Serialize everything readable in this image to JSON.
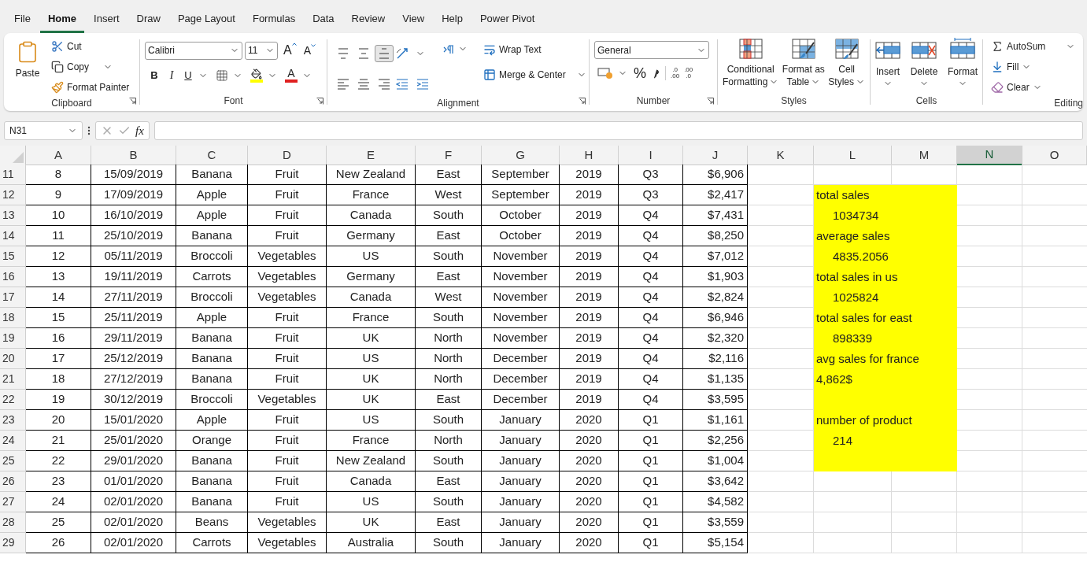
{
  "menu_tabs": [
    {
      "label": "File",
      "selected": false
    },
    {
      "label": "Home",
      "selected": true
    },
    {
      "label": "Insert",
      "selected": false
    },
    {
      "label": "Draw",
      "selected": false
    },
    {
      "label": "Page Layout",
      "selected": false
    },
    {
      "label": "Formulas",
      "selected": false
    },
    {
      "label": "Data",
      "selected": false
    },
    {
      "label": "Review",
      "selected": false
    },
    {
      "label": "View",
      "selected": false
    },
    {
      "label": "Help",
      "selected": false
    },
    {
      "label": "Power Pivot",
      "selected": false
    }
  ],
  "clipboard": {
    "paste": "Paste",
    "cut": "Cut",
    "copy": "Copy",
    "format_painter": "Format Painter",
    "label": "Clipboard"
  },
  "font": {
    "name": "Calibri",
    "size": "11",
    "grow": "A",
    "shrink": "A",
    "bold": "B",
    "italic": "I",
    "underline": "U",
    "font_color": "A",
    "label": "Font"
  },
  "alignment": {
    "wrap_text": "Wrap Text",
    "merge_center": "Merge & Center",
    "label": "Alignment"
  },
  "number": {
    "format": "General",
    "percent": "%",
    "increase_decimal": [
      ".0",
      ".00"
    ],
    "decrease_decimal": [
      ".00",
      ".0"
    ],
    "label": "Number"
  },
  "styles": {
    "buttons": [
      [
        "Conditional",
        "Formatting"
      ],
      [
        "Format as",
        "Table"
      ],
      [
        "Cell",
        "Styles"
      ]
    ],
    "label": "Styles"
  },
  "cells": {
    "buttons": [
      "Insert",
      "Delete",
      "Format"
    ],
    "label": "Cells"
  },
  "editing": {
    "autosum": "AutoSum",
    "fill": "Fill",
    "clear": "Clear",
    "label": "Editing"
  },
  "formula_bar": {
    "name_box": "N31",
    "fx": "fx"
  },
  "columns": [
    {
      "label": "A",
      "selected": false
    },
    {
      "label": "B",
      "selected": false
    },
    {
      "label": "C",
      "selected": false
    },
    {
      "label": "D",
      "selected": false
    },
    {
      "label": "E",
      "selected": false
    },
    {
      "label": "F",
      "selected": false
    },
    {
      "label": "G",
      "selected": false
    },
    {
      "label": "H",
      "selected": false
    },
    {
      "label": "I",
      "selected": false
    },
    {
      "label": "J",
      "selected": false
    },
    {
      "label": "K",
      "selected": false
    },
    {
      "label": "L",
      "selected": false
    },
    {
      "label": "M",
      "selected": false
    },
    {
      "label": "N",
      "selected": true
    },
    {
      "label": "O",
      "selected": false
    }
  ],
  "rows": [
    {
      "number": "11",
      "cells": [
        "8",
        "15/09/2019",
        "Banana",
        "Fruit",
        "New Zealand",
        "East",
        "September",
        "2019",
        "Q3",
        "$6,906"
      ],
      "highlight": false
    },
    {
      "number": "12",
      "cells": [
        "9",
        "17/09/2019",
        "Apple",
        "Fruit",
        "France",
        "West",
        "September",
        "2019",
        "Q3",
        "$2,417"
      ],
      "highlight": true,
      "note": {
        "text": "total sales",
        "kind": "label"
      }
    },
    {
      "number": "13",
      "cells": [
        "10",
        "16/10/2019",
        "Apple",
        "Fruit",
        "Canada",
        "South",
        "October",
        "2019",
        "Q4",
        "$7,431"
      ],
      "highlight": true,
      "note": {
        "text": "1034734",
        "kind": "value"
      }
    },
    {
      "number": "14",
      "cells": [
        "11",
        "25/10/2019",
        "Banana",
        "Fruit",
        "Germany",
        "East",
        "October",
        "2019",
        "Q4",
        "$8,250"
      ],
      "highlight": true,
      "note": {
        "text": "average sales",
        "kind": "label"
      }
    },
    {
      "number": "15",
      "cells": [
        "12",
        "05/11/2019",
        "Broccoli",
        "Vegetables",
        "US",
        "South",
        "November",
        "2019",
        "Q4",
        "$7,012"
      ],
      "highlight": true,
      "note": {
        "text": "4835.2056",
        "kind": "value"
      }
    },
    {
      "number": "16",
      "cells": [
        "13",
        "19/11/2019",
        "Carrots",
        "Vegetables",
        "Germany",
        "East",
        "November",
        "2019",
        "Q4",
        "$1,903"
      ],
      "highlight": true,
      "note": {
        "text": "total sales in us",
        "kind": "label"
      }
    },
    {
      "number": "17",
      "cells": [
        "14",
        "27/11/2019",
        "Broccoli",
        "Vegetables",
        "Canada",
        "West",
        "November",
        "2019",
        "Q4",
        "$2,824"
      ],
      "highlight": true,
      "note": {
        "text": "1025824",
        "kind": "value"
      }
    },
    {
      "number": "18",
      "cells": [
        "15",
        "25/11/2019",
        "Apple",
        "Fruit",
        "France",
        "South",
        "November",
        "2019",
        "Q4",
        "$6,946"
      ],
      "highlight": true,
      "note": {
        "text": "total sales for east",
        "kind": "label"
      }
    },
    {
      "number": "19",
      "cells": [
        "16",
        "29/11/2019",
        "Banana",
        "Fruit",
        "UK",
        "North",
        "November",
        "2019",
        "Q4",
        "$2,320"
      ],
      "highlight": true,
      "note": {
        "text": "898339",
        "kind": "value"
      }
    },
    {
      "number": "20",
      "cells": [
        "17",
        "25/12/2019",
        "Banana",
        "Fruit",
        "US",
        "North",
        "December",
        "2019",
        "Q4",
        "$2,116"
      ],
      "highlight": true,
      "note": {
        "text": "avg sales for france",
        "kind": "label"
      }
    },
    {
      "number": "21",
      "cells": [
        "18",
        "27/12/2019",
        "Banana",
        "Fruit",
        "UK",
        "North",
        "December",
        "2019",
        "Q4",
        "$1,135"
      ],
      "highlight": true,
      "note": {
        "text": "4,862$",
        "kind": "label"
      }
    },
    {
      "number": "22",
      "cells": [
        "19",
        "30/12/2019",
        "Broccoli",
        "Vegetables",
        "UK",
        "East",
        "December",
        "2019",
        "Q4",
        "$3,595"
      ],
      "highlight": true
    },
    {
      "number": "23",
      "cells": [
        "20",
        "15/01/2020",
        "Apple",
        "Fruit",
        "US",
        "South",
        "January",
        "2020",
        "Q1",
        "$1,161"
      ],
      "highlight": true,
      "note": {
        "text": "number of product",
        "kind": "label"
      }
    },
    {
      "number": "24",
      "cells": [
        "21",
        "25/01/2020",
        "Orange",
        "Fruit",
        "France",
        "North",
        "January",
        "2020",
        "Q1",
        "$2,256"
      ],
      "highlight": true,
      "note": {
        "text": "214",
        "kind": "value"
      }
    },
    {
      "number": "25",
      "cells": [
        "22",
        "29/01/2020",
        "Banana",
        "Fruit",
        "New Zealand",
        "South",
        "January",
        "2020",
        "Q1",
        "$1,004"
      ],
      "highlight": true
    },
    {
      "number": "26",
      "cells": [
        "23",
        "01/01/2020",
        "Banana",
        "Fruit",
        "Canada",
        "East",
        "January",
        "2020",
        "Q1",
        "$3,642"
      ],
      "highlight": false
    },
    {
      "number": "27",
      "cells": [
        "24",
        "02/01/2020",
        "Banana",
        "Fruit",
        "US",
        "South",
        "January",
        "2020",
        "Q1",
        "$4,582"
      ],
      "highlight": false
    },
    {
      "number": "28",
      "cells": [
        "25",
        "02/01/2020",
        "Beans",
        "Vegetables",
        "UK",
        "East",
        "January",
        "2020",
        "Q1",
        "$3,559"
      ],
      "highlight": false
    },
    {
      "number": "29",
      "cells": [
        "26",
        "02/01/2020",
        "Carrots",
        "Vegetables",
        "Australia",
        "South",
        "January",
        "2020",
        "Q1",
        "$5,154"
      ],
      "highlight": false
    }
  ]
}
